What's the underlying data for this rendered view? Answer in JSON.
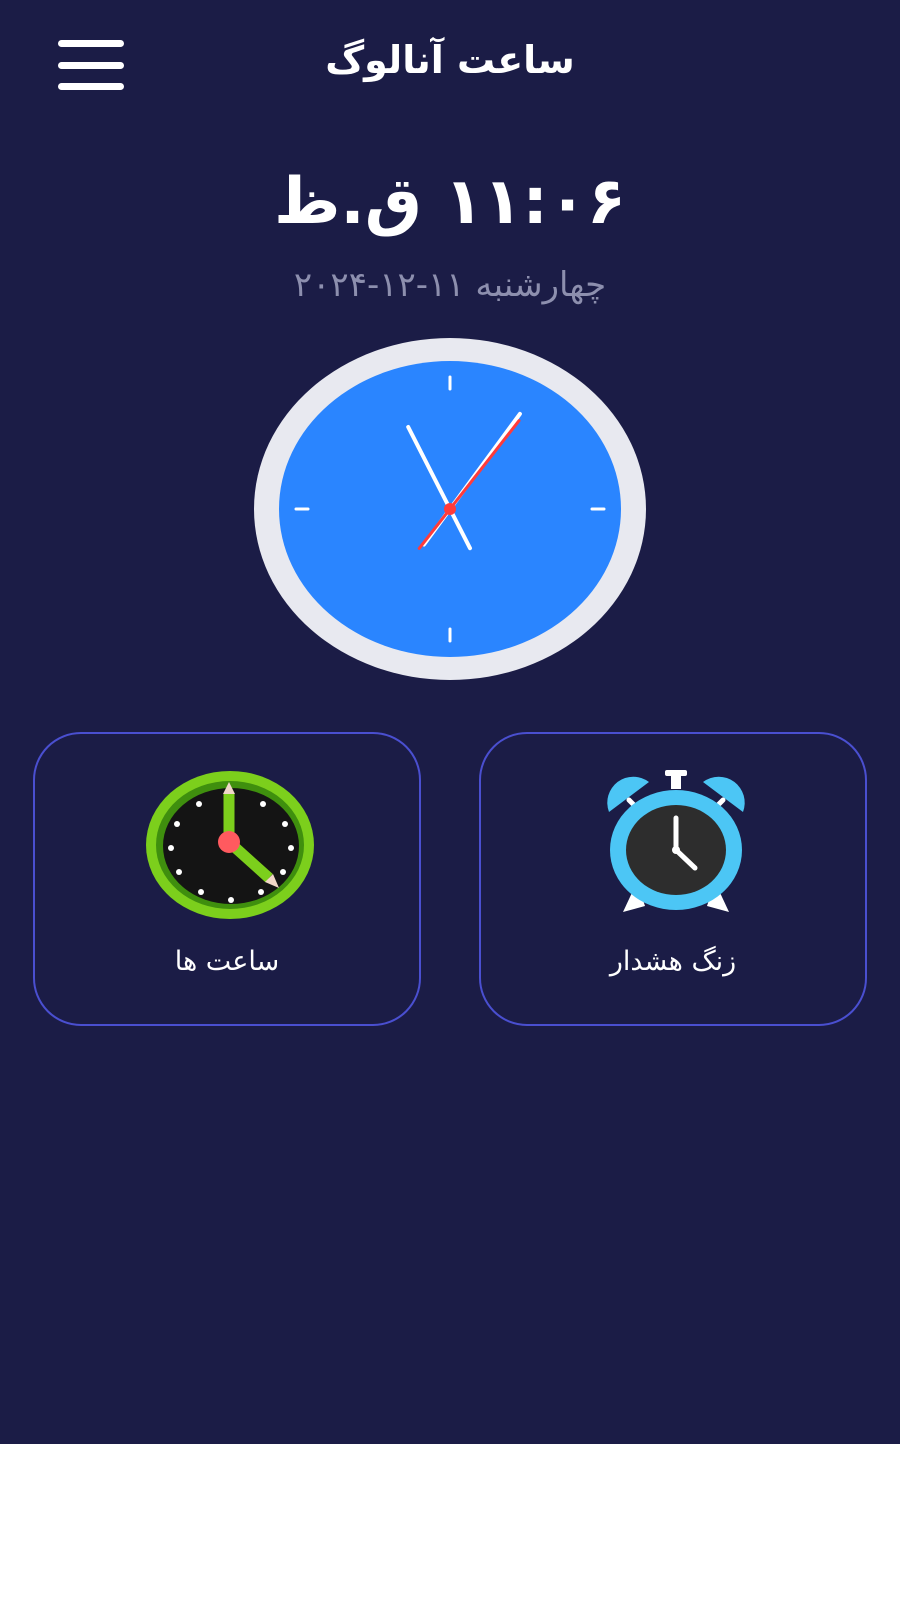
{
  "header": {
    "title": "ساعت آنالوگ",
    "menu_icon": "hamburger-menu-icon"
  },
  "clock": {
    "digital_time": "۱۱:۰۶ ق.ظ",
    "date": "چهارشنبه ۱۱-۱۲-۲۰۲۴",
    "analog": {
      "hours": 11,
      "minutes": 6,
      "seconds": 3
    }
  },
  "cards": [
    {
      "label": "زنگ هشدار",
      "icon": "alarm-clock-icon"
    },
    {
      "label": "ساعت ها",
      "icon": "clock-pencil-icon"
    }
  ],
  "colors": {
    "background": "#1b1c46",
    "clock_face": "#2a85ff",
    "clock_rim": "#e8e9f0",
    "second_hand": "#ff3b3b",
    "card_border": "#4a4fd0",
    "alarm_blue": "#4cc6f5",
    "clock_green": "#7ccf1c"
  }
}
